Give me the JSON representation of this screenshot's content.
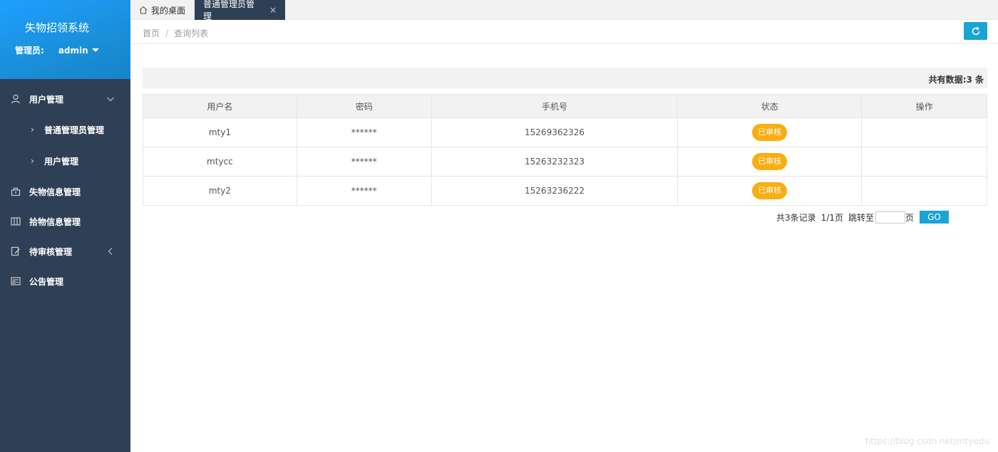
{
  "app": {
    "title": "失物招领系统",
    "admin_label": "管理员:",
    "admin_name": "admin"
  },
  "sidebar": {
    "items": [
      {
        "label": "用户管理",
        "icon": "user-icon",
        "arrow": "chevron-down-icon",
        "children": [
          {
            "label": "普通管理员管理"
          },
          {
            "label": "用户管理"
          }
        ]
      },
      {
        "label": "失物信息管理",
        "icon": "bag-icon"
      },
      {
        "label": "拾物信息管理",
        "icon": "columns-icon"
      },
      {
        "label": "待审核管理",
        "icon": "edit-icon",
        "arrow": "chevron-left-icon"
      },
      {
        "label": "公告管理",
        "icon": "notice-icon"
      }
    ]
  },
  "tabs": [
    {
      "label": "我的桌面",
      "icon": "home-icon"
    },
    {
      "label": "普通管理员管理",
      "close": "×"
    }
  ],
  "breadcrumb": {
    "home": "首页",
    "sep": "/",
    "current": "查询列表"
  },
  "summary": {
    "text": "共有数据:3 条"
  },
  "table": {
    "headers": [
      "用户名",
      "密码",
      "手机号",
      "状态",
      "操作"
    ],
    "rows": [
      {
        "username": "mty1",
        "password": "******",
        "phone": "15269362326",
        "status": "已审核"
      },
      {
        "username": "mtycc",
        "password": "******",
        "phone": "15263232323",
        "status": "已审核"
      },
      {
        "username": "mty2",
        "password": "******",
        "phone": "15263236222",
        "status": "已审核"
      }
    ]
  },
  "pager": {
    "records": "共3条记录",
    "pages": "1/1页",
    "jump_label": "跳转至",
    "page_unit": "页",
    "go": "GO",
    "jump_value": ""
  },
  "watermark": "https://blog.csdn.net/mtyedu",
  "colors": {
    "sidebar": "#2f4056",
    "header_blue": "#1E9FFF",
    "accent": "#1aa4d6",
    "badge": "#f9ae10"
  }
}
